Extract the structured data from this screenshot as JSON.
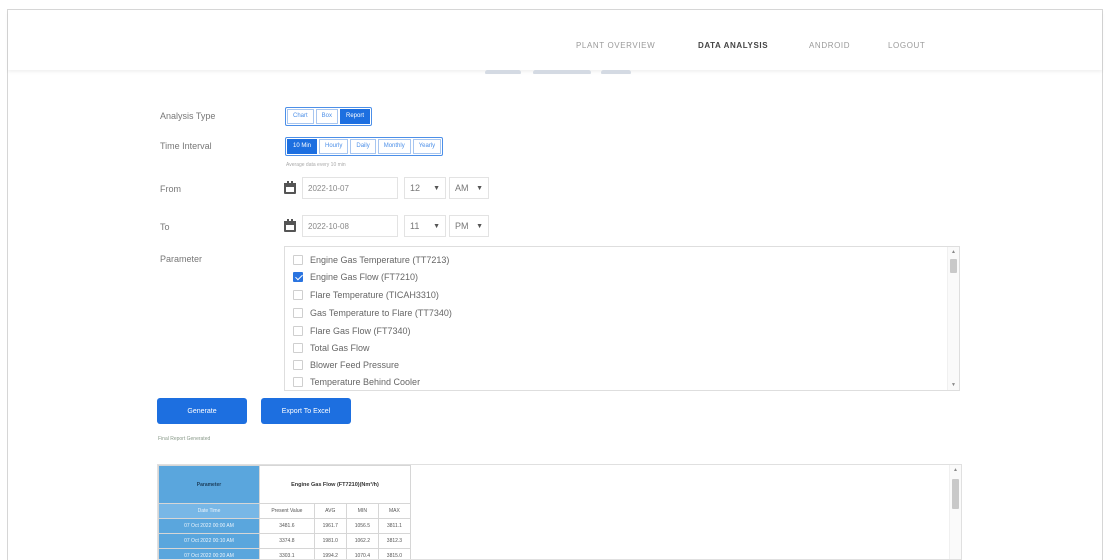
{
  "nav": {
    "items": [
      {
        "label": "PLANT OVERVIEW",
        "active": false
      },
      {
        "label": "DATA ANALYSIS",
        "active": true
      },
      {
        "label": "ANDROID",
        "active": false
      },
      {
        "label": "LOGOUT",
        "active": false
      }
    ]
  },
  "form": {
    "analysis_type": {
      "label": "Analysis Type",
      "options": [
        "Chart",
        "Box",
        "Report"
      ],
      "selected": "Report"
    },
    "time_interval": {
      "label": "Time Interval",
      "options": [
        "10 Min",
        "Hourly",
        "Daily",
        "Monthly",
        "Yearly"
      ],
      "selected": "10 Min",
      "hint": "Average data every 10 min"
    },
    "from": {
      "label": "From",
      "date": "2022-10-07",
      "hour": "12",
      "ampm": "AM"
    },
    "to": {
      "label": "To",
      "date": "2022-10-08",
      "hour": "11",
      "ampm": "PM"
    },
    "parameter": {
      "label": "Parameter",
      "items": [
        {
          "label": "Engine Gas Temperature (TT7213)",
          "checked": false
        },
        {
          "label": "Engine Gas Flow (FT7210)",
          "checked": true
        },
        {
          "label": "Flare Temperature (TICAH3310)",
          "checked": false
        },
        {
          "label": "Gas Temperature to Flare (TT7340)",
          "checked": false
        },
        {
          "label": "Flare Gas Flow (FT7340)",
          "checked": false
        },
        {
          "label": "Total Gas Flow",
          "checked": false
        },
        {
          "label": "Blower Feed Pressure",
          "checked": false
        },
        {
          "label": "Temperature Behind Cooler",
          "checked": false
        }
      ]
    }
  },
  "actions": {
    "generate_label": "Generate",
    "export_label": "Export To Excel",
    "status": "Final Report Generated"
  },
  "report": {
    "side_header": "Parameter",
    "date_time_label": "Date Time",
    "column_header": "Engine Gas Flow (FT7210)(Nm³/h)",
    "sub_headers": [
      "Present Value",
      "AVG",
      "MIN",
      "MAX"
    ],
    "rows": [
      {
        "time": "07 Oct 2022 00:00 AM",
        "values": [
          "3481.6",
          "1961.7",
          "1056.5",
          "3811.1"
        ]
      },
      {
        "time": "07 Oct 2022 00:10 AM",
        "values": [
          "3374.8",
          "1981.0",
          "1062.2",
          "3812.3"
        ]
      },
      {
        "time": "07 Oct 2022 00:20 AM",
        "values": [
          "3303.1",
          "1994.2",
          "1070.4",
          "3815.0"
        ]
      }
    ]
  }
}
